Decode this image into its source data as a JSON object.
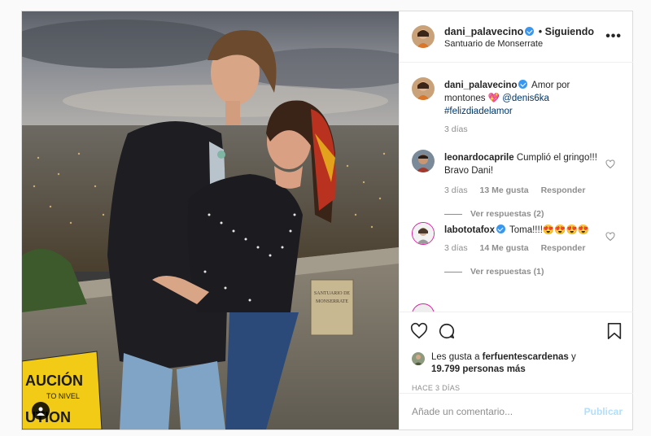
{
  "header": {
    "username": "dani_palavecino",
    "separator": "•",
    "follow_status": "Siguiendo",
    "location": "Santuario de Monserrate",
    "more_icon": "more-horizontal-icon"
  },
  "caption": {
    "username": "dani_palavecino",
    "text": "Amor por montones 💖",
    "mention": "@denis6ka",
    "hashtag": "#felizdiadelamor",
    "time": "3 días"
  },
  "comments": [
    {
      "username": "leonardocaprile",
      "text": "Cumplió el gringo!!! Bravo Dani!",
      "time": "3 días",
      "likes": "13 Me gusta",
      "reply": "Responder",
      "view_replies": "Ver respuestas (2)"
    },
    {
      "username": "labototafox",
      "text": "Toma!!!!😍😍😍😍",
      "time": "3 días",
      "likes": "14 Me gusta",
      "reply": "Responder",
      "view_replies": "Ver respuestas (1)"
    }
  ],
  "likes": {
    "prefix": "Les gusta a",
    "user": "ferfuentescardenas",
    "connector": "y",
    "others": "19.799 personas más"
  },
  "timestamp": "HACE 3 DÍAS",
  "comment_box": {
    "placeholder": "Añade un comentario...",
    "publish": "Publicar"
  },
  "photo": {
    "sign_text_1": "AUCIÓN",
    "sign_text_2": "TO NIVEL",
    "sign_text_3": "UTION",
    "plaque_text_1": "SANTUARIO DE",
    "plaque_text_2": "MONSERRATE"
  },
  "colors": {
    "verified": "#3897f0",
    "link": "#003569",
    "publish_disabled": "#b2dffc"
  }
}
